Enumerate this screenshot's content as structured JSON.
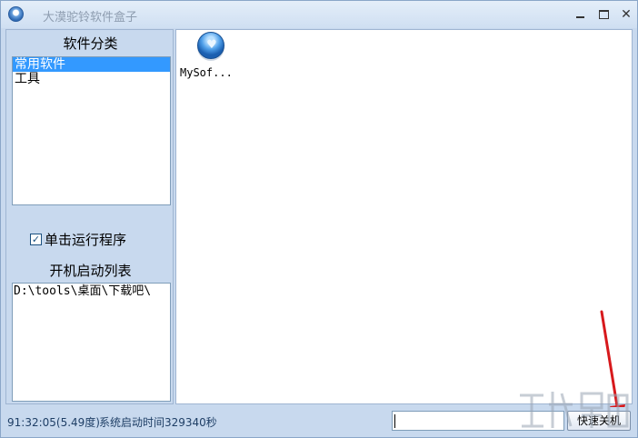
{
  "window": {
    "title": "大漠驼铃软件盒子"
  },
  "left_panel": {
    "category_title": "软件分类",
    "categories": [
      {
        "label": "常用软件",
        "selected": true
      },
      {
        "label": "工具",
        "selected": false
      }
    ],
    "single_click_label": "单击运行程序",
    "single_click_checked": true,
    "startup_title": "开机启动列表",
    "startup_items": [
      "D:\\tools\\桌面\\下载吧\\"
    ]
  },
  "main": {
    "items": [
      {
        "label": "MySof...",
        "icon": "heart-bubble-icon"
      }
    ]
  },
  "status": {
    "time": "91:32:05(5.49度)",
    "uptime": "系统启动时间329340秒",
    "command_value": "",
    "shutdown_label": "快速关机"
  },
  "colors": {
    "window_bg": "#c8d9ee",
    "selection": "#3399ff",
    "arrow": "#d7191c"
  }
}
